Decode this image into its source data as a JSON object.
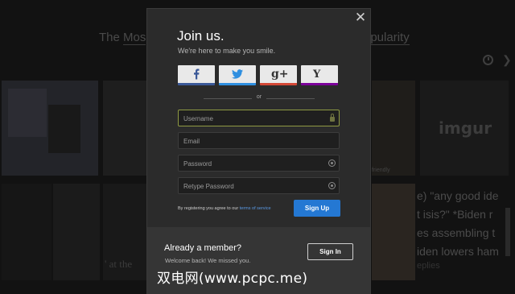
{
  "background": {
    "header_left": "The",
    "header_left_link": "Mos",
    "header_right": "opularity",
    "imgur_logo": "imgur",
    "tweet_lines": [
      "e) \"any good ide",
      "t isis?\" *Biden r",
      "es assembling t",
      "iden lowers ham"
    ],
    "replies_text": "eplies",
    "caption_text": "' at the",
    "tile_hint": "friendly"
  },
  "modal": {
    "close_icon": "close-icon",
    "title": "Join us.",
    "subtitle": "We're here to make you smile.",
    "social": [
      {
        "name": "facebook",
        "color": "#3b5998"
      },
      {
        "name": "twitter",
        "color": "#2f8fe0"
      },
      {
        "name": "google-plus",
        "label": "g+",
        "color": "#d34836"
      },
      {
        "name": "yahoo",
        "label": "Y",
        "color": "#7b0099"
      }
    ],
    "or_text": "or",
    "fields": {
      "username_placeholder": "Username",
      "email_placeholder": "Email",
      "password_placeholder": "Password",
      "retype_placeholder": "Retype Password"
    },
    "terms_prefix": "By registering you agree to our",
    "terms_link": "terms of service",
    "signup_label": "Sign Up",
    "footer": {
      "heading": "Already a member?",
      "subtext": "Welcome back! We missed you.",
      "signin_label": "Sign In"
    }
  },
  "watermark": "双电网(www.pcpc.me)",
  "colors": {
    "accent": "#2478d3",
    "focus_border": "#8f9a43",
    "link": "#5b9be6"
  }
}
